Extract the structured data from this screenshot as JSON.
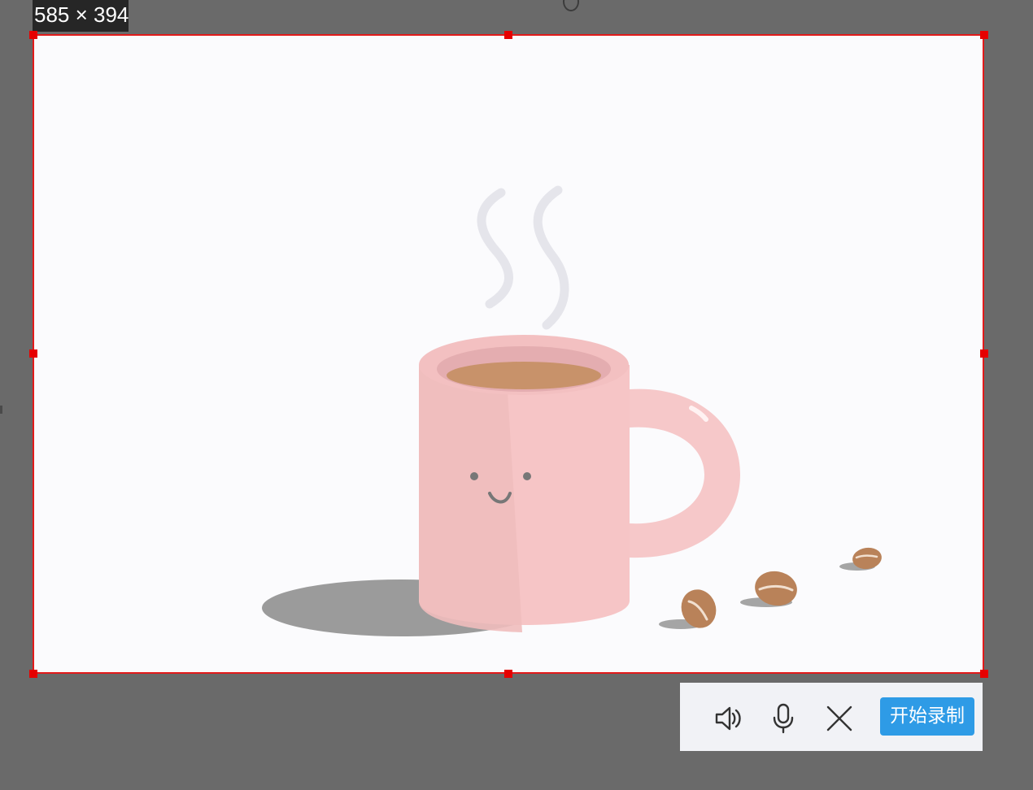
{
  "capture": {
    "size_label": "585 × 394",
    "border_color": "#e21a1a",
    "handle_color": "#e60000"
  },
  "toolbar": {
    "speaker_icon": "speaker-icon",
    "microphone_icon": "microphone-icon",
    "close_icon": "close-icon",
    "record_label": "开始录制",
    "record_color": "#2e9be6"
  }
}
